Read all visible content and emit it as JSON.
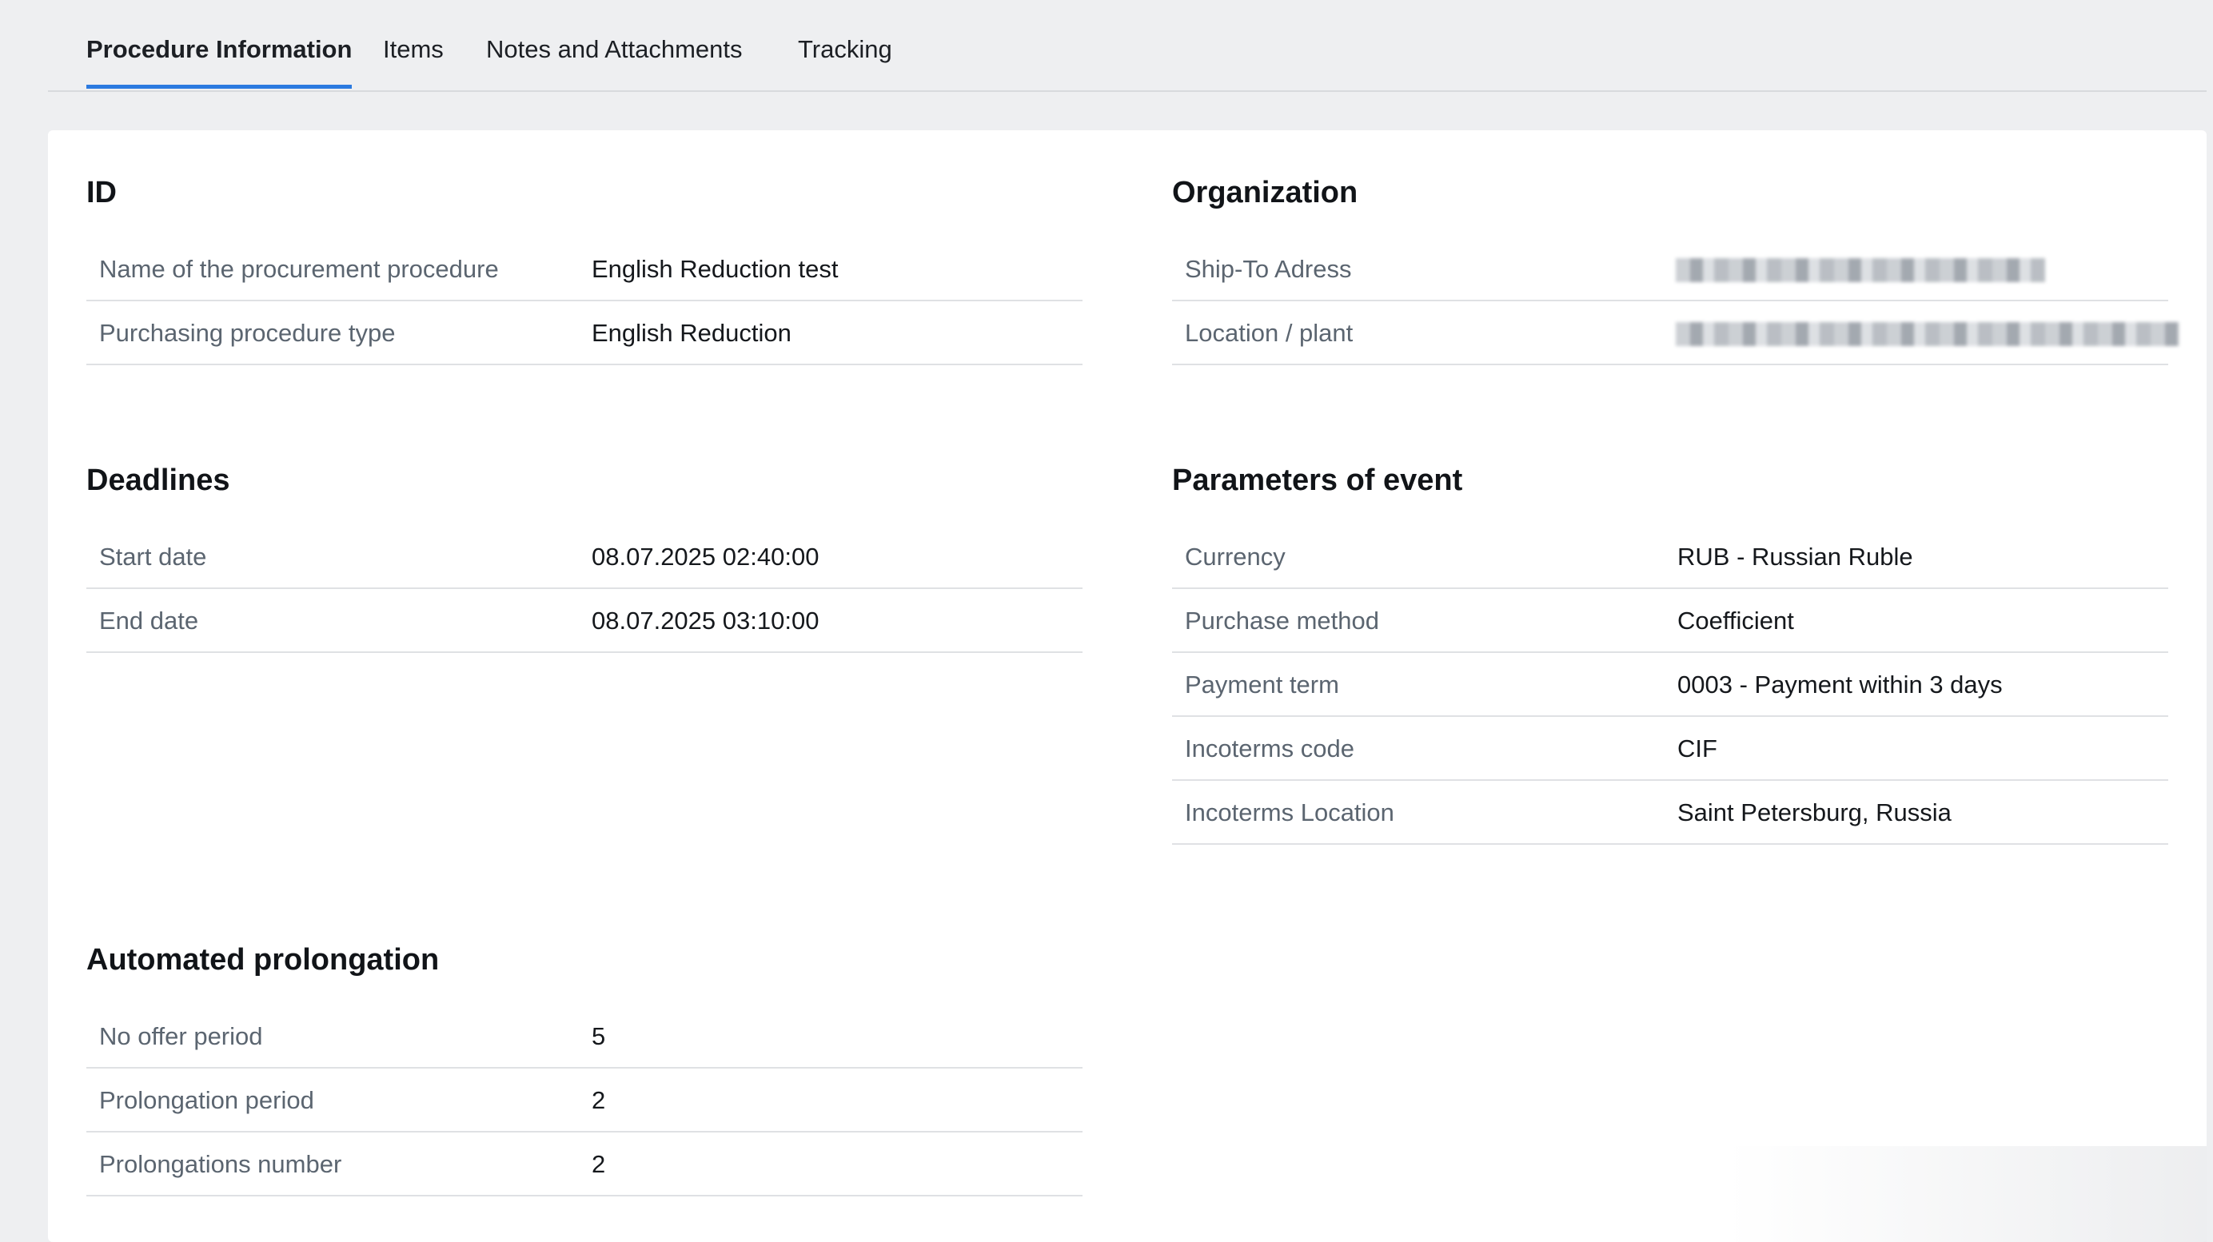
{
  "tabs": [
    {
      "label": "Procedure Information",
      "active": true
    },
    {
      "label": "Items",
      "active": false
    },
    {
      "label": "Notes and Attachments",
      "active": false
    },
    {
      "label": "Tracking",
      "active": false
    }
  ],
  "sections": {
    "id": {
      "title": "ID",
      "rows": [
        {
          "label": "Name of the procurement procedure",
          "value": "English Reduction test"
        },
        {
          "label": "Purchasing procedure type",
          "value": "English Reduction"
        }
      ]
    },
    "organization": {
      "title": "Organization",
      "rows": [
        {
          "label": "Ship-To Adress",
          "value": ""
        },
        {
          "label": "Location / plant",
          "value": ""
        }
      ]
    },
    "deadlines": {
      "title": "Deadlines",
      "rows": [
        {
          "label": "Start date",
          "value": "08.07.2025 02:40:00"
        },
        {
          "label": "End date",
          "value": "08.07.2025 03:10:00"
        }
      ]
    },
    "parameters": {
      "title": "Parameters of event",
      "rows": [
        {
          "label": "Currency",
          "value": "RUB - Russian Ruble"
        },
        {
          "label": "Purchase method",
          "value": "Coefficient"
        },
        {
          "label": "Payment term",
          "value": "0003 - Payment within 3 days"
        },
        {
          "label": "Incoterms code",
          "value": "CIF"
        },
        {
          "label": "Incoterms Location",
          "value": "Saint Petersburg, Russia"
        }
      ]
    },
    "prolongation": {
      "title": "Automated prolongation",
      "rows": [
        {
          "label": "No offer period",
          "value": "5"
        },
        {
          "label": "Prolongation period",
          "value": "2"
        },
        {
          "label": "Prolongations number",
          "value": "2"
        }
      ]
    }
  },
  "colors": {
    "accent": "#2b7ae0",
    "background": "#eeeff1",
    "card": "#ffffff",
    "label": "#5b6570"
  }
}
